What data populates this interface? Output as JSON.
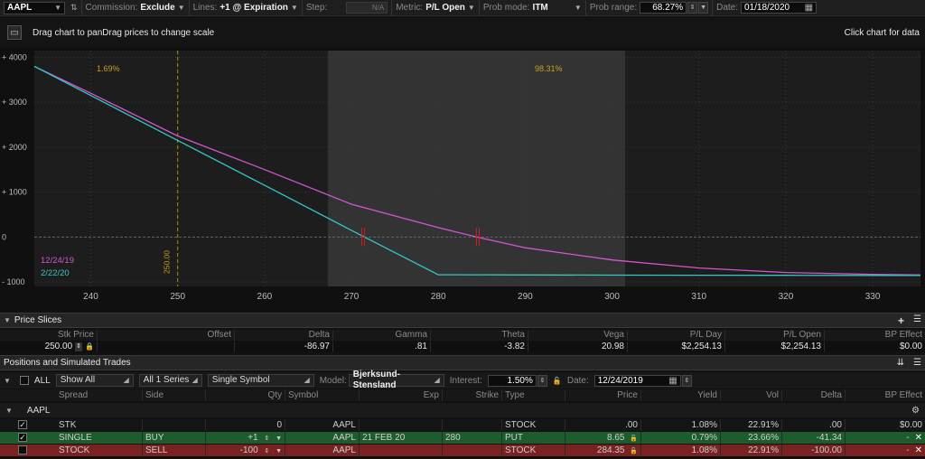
{
  "toolbar": {
    "symbol": "AAPL",
    "commission_label": "Commission:",
    "commission_value": "Exclude",
    "lines_label": "Lines:",
    "lines_value": "+1 @ Expiration",
    "step_label": "Step:",
    "step_value": "N/A",
    "metric_label": "Metric:",
    "metric_value": "P/L Open",
    "prob_mode_label": "Prob mode:",
    "prob_mode_value": "ITM",
    "prob_range_label": "Prob range:",
    "prob_range_value": "68.27%",
    "date_label": "Date:",
    "date_value": "01/18/2020"
  },
  "chart_header": {
    "hint_left": "Drag chart to panDrag prices to change scale",
    "hint_right": "Click chart for data"
  },
  "chart_data": {
    "type": "line",
    "x_ticks": [
      240,
      250,
      260,
      270,
      280,
      290,
      300,
      310,
      320,
      330
    ],
    "y_ticks": [
      "+ 4000",
      "+ 3000",
      "+ 2000",
      "+ 1000",
      "0",
      "- 1000"
    ],
    "xlim": [
      233.5,
      335.5
    ],
    "ylim": [
      -1100,
      4150
    ],
    "prob_band": [
      267.3,
      301.5
    ],
    "left_prob_label": "1.69%",
    "band_prob_label": "98.31%",
    "price_marker": 250,
    "price_marker_label": "250.00",
    "series": [
      {
        "name": "12/24/19",
        "color": "#d455d4",
        "points": [
          [
            233.5,
            3800
          ],
          [
            240,
            3200
          ],
          [
            250,
            2250
          ],
          [
            260,
            1500
          ],
          [
            270,
            730
          ],
          [
            280,
            210
          ],
          [
            284.4,
            0
          ],
          [
            290,
            -240
          ],
          [
            300,
            -510
          ],
          [
            310,
            -690
          ],
          [
            320,
            -790
          ],
          [
            330,
            -830
          ],
          [
            335.5,
            -845
          ]
        ]
      },
      {
        "name": "2/22/20",
        "color": "#33c8c4",
        "points": [
          [
            233.5,
            3800
          ],
          [
            240,
            3150
          ],
          [
            250,
            2150
          ],
          [
            260,
            1150
          ],
          [
            270,
            150
          ],
          [
            280,
            -840
          ],
          [
            290,
            -845
          ],
          [
            300,
            -848
          ],
          [
            310,
            -850
          ],
          [
            320,
            -852
          ],
          [
            330,
            -855
          ],
          [
            335.5,
            -855
          ]
        ]
      }
    ],
    "markers": [
      [
        271.3,
        0
      ],
      [
        284.5,
        0
      ]
    ]
  },
  "price_slices": {
    "title": "Price Slices",
    "headers": [
      "Stk Price",
      "Offset",
      "Delta",
      "Gamma",
      "Theta",
      "Vega",
      "P/L Day",
      "P/L Open",
      "BP Effect"
    ],
    "row": {
      "stk_price": "250.00",
      "offset": "",
      "delta": "-86.97",
      "gamma": ".81",
      "theta": "-3.82",
      "vega": "20.98",
      "pl_day": "$2,254.13",
      "pl_open": "$2,254.13",
      "bp_effect": "$0.00"
    }
  },
  "positions": {
    "title": "Positions and Simulated Trades",
    "all_label": "ALL",
    "show_all": "Show All",
    "series": "All 1 Series",
    "symbol_mode": "Single Symbol",
    "model_label": "Model:",
    "model_value": "Bjerksund-Stensland",
    "interest_label": "Interest:",
    "interest_value": "1.50%",
    "date_label": "Date:",
    "date_value": "12/24/2019",
    "headers": [
      "Spread",
      "Side",
      "Qty",
      "Symbol",
      "Exp",
      "Strike",
      "Type",
      "Price",
      "Yield",
      "Vol",
      "Delta",
      "BP Effect"
    ],
    "group": "AAPL",
    "rows": [
      {
        "spread": "STK",
        "side": "",
        "qty": "0",
        "symbol": "AAPL",
        "exp": "",
        "strike": "",
        "type": "STOCK",
        "price": ".00",
        "yield": "1.08%",
        "vol": "22.91%",
        "delta": ".00",
        "bp": "$0.00"
      },
      {
        "spread": "SINGLE",
        "side": "BUY",
        "qty": "+1",
        "symbol": "AAPL",
        "exp": "21 FEB 20",
        "strike": "280",
        "type": "PUT",
        "price": "8.65",
        "yield": "0.79%",
        "vol": "23.66%",
        "delta": "-41.34",
        "bp": "-"
      },
      {
        "spread": "STOCK",
        "side": "SELL",
        "qty": "-100",
        "symbol": "AAPL",
        "exp": "",
        "strike": "",
        "type": "STOCK",
        "price": "284.35",
        "yield": "1.08%",
        "vol": "22.91%",
        "delta": "-100.00",
        "bp": "-"
      }
    ]
  }
}
